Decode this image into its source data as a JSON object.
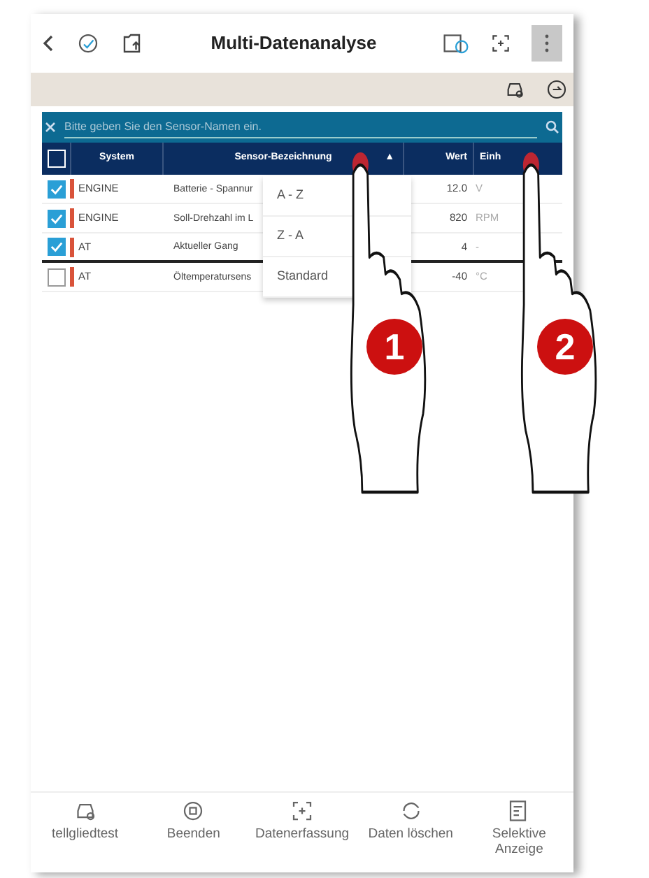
{
  "header": {
    "title": "Multi-Datenanalyse"
  },
  "search": {
    "placeholder": "Bitte geben Sie den Sensor-Namen ein."
  },
  "table": {
    "select_all": {
      "checked": false
    },
    "columns": [
      {
        "label": "System"
      },
      {
        "label": "Sensor-Bezeichnung",
        "sort": "▲"
      },
      {
        "label": "Wert"
      },
      {
        "label": "Einh"
      }
    ],
    "rows": [
      {
        "checked": true,
        "system": "ENGINE",
        "sensor": "Batterie - Spannur",
        "value": "12.0",
        "unit": "V"
      },
      {
        "checked": true,
        "system": "ENGINE",
        "sensor": "Soll-Drehzahl im L",
        "value": "820",
        "unit": "RPM"
      },
      {
        "checked": true,
        "system": "AT",
        "sensor": "Aktueller Gang",
        "value": "4",
        "unit": "-"
      },
      {
        "checked": false,
        "system": "AT",
        "sensor": "Öltemperatursens",
        "value": "-40",
        "unit": "°C"
      }
    ]
  },
  "sort_menu": [
    "A - Z",
    "Z - A",
    "Standard"
  ],
  "gesture_badges": [
    "1",
    "2"
  ],
  "bottom_nav": [
    "tellgliedtest",
    "Beenden",
    "Datenerfassung",
    "Daten löschen",
    "Selektive Anzeige"
  ]
}
